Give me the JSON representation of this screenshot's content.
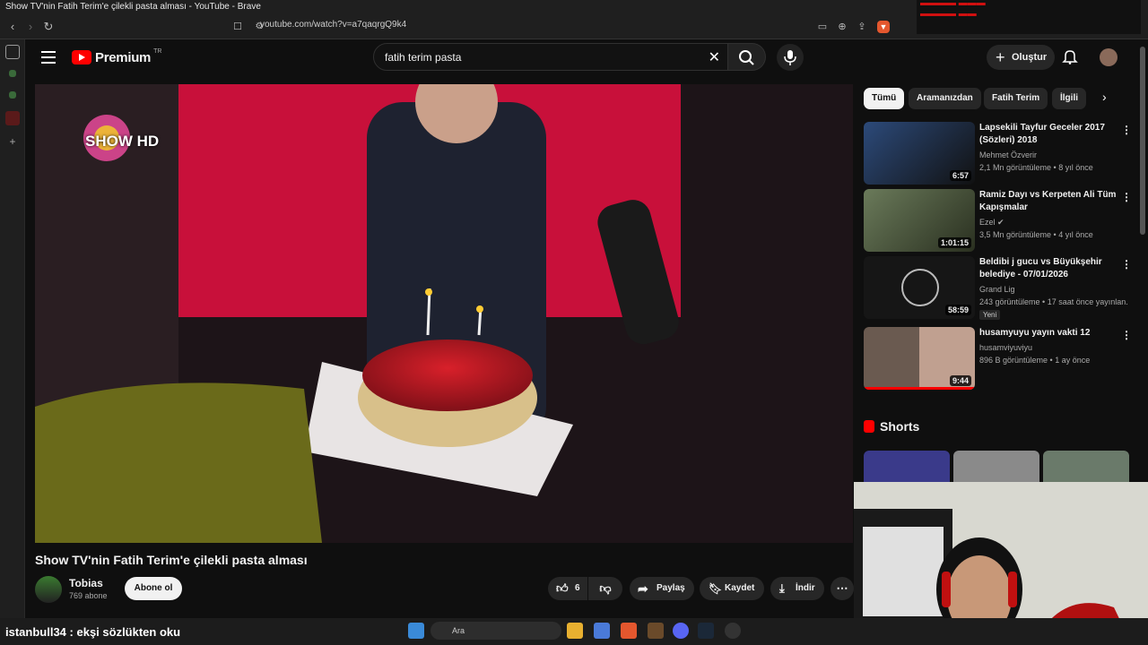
{
  "window": {
    "title": "Show TV'nin Fatih Terim'e çilekli pasta alması - YouTube - Brave",
    "url": "youtube.com/watch?v=a7qaqrgQ9k4",
    "controls": [
      "—",
      "❐",
      "✕"
    ]
  },
  "youtube": {
    "logo_text": "Premium",
    "logo_region": "TR",
    "search_query": "fatih terim pasta",
    "create_label": "Oluştur"
  },
  "video": {
    "title": "Show TV'nin Fatih Terim'e çilekli pasta alması",
    "overlay_logo": "SHOW HD",
    "channel": "Tobias",
    "subscribers": "769 abone",
    "subscribe_label": "Abone ol",
    "likes": "6",
    "share_label": "Paylaş",
    "save_label": "Kaydet",
    "download_label": "İndir"
  },
  "chips": [
    "Tümü",
    "Aramanızdan",
    "Fatih Terim",
    "İlgili"
  ],
  "recommendations": [
    {
      "title": "Lapsekili Tayfur Geceler 2017 (Sözleri) 2018",
      "channel": "Mehmet Özverir",
      "meta": "2,1 Mn görüntüleme • 8 yıl önce",
      "duration": "6:57",
      "color": "#2c4a7a"
    },
    {
      "title": "Ramiz Dayı vs Kerpeten Ali Tüm Kapışmalar",
      "channel": "Ezel",
      "meta": "3,5 Mn görüntüleme • 4 yıl önce",
      "duration": "1:01:15",
      "color": "#4a5a3a"
    },
    {
      "title": "Beldibi j gucu vs Büyükşehir belediye - 07/01/2026",
      "channel": "Grand Lig",
      "meta": "243 görüntüleme • 17 saat önce yayınlan...",
      "badge": "Yeni",
      "duration": "58:59",
      "color": "#1a1a1a"
    },
    {
      "title": "husamyuyu yayın vakti 12",
      "channel": "husamviyuviyu",
      "meta": "896 B görüntüleme • 1 ay önce",
      "duration": "9:44",
      "color": "#5a4a40"
    }
  ],
  "shorts_label": "Shorts",
  "taskbar": {
    "search_placeholder": "Ara",
    "chat_user": "istanbull34",
    "chat_message": ": ekşi sözlükten oku"
  }
}
